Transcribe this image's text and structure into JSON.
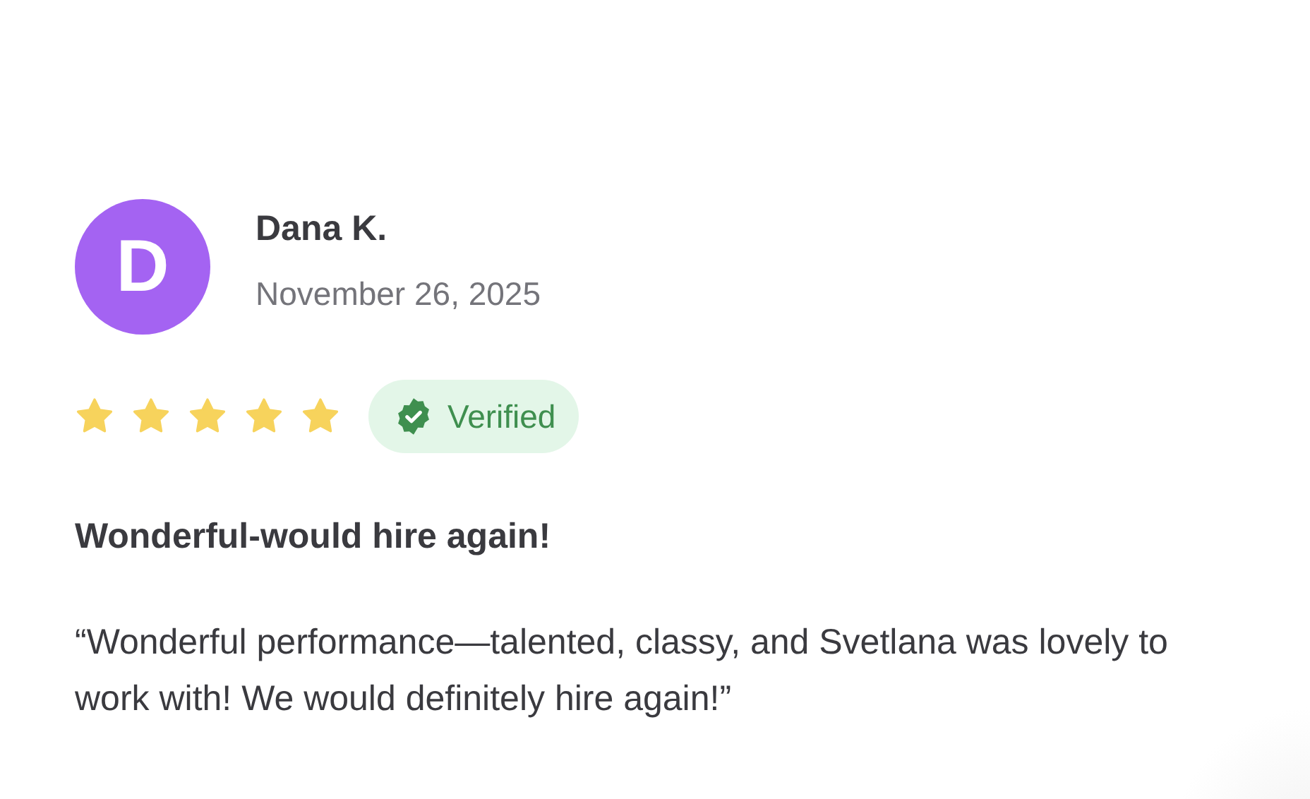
{
  "review": {
    "initial": "D",
    "name": "Dana K.",
    "date": "November 26, 2025",
    "stars": 5,
    "verified": true,
    "badge": "Verified",
    "title": "Wonderful-would hire again!",
    "text": "“Wonderful performance—talented, classy, and Svetlana was lovely to work with! We would definitely hire again!”"
  }
}
